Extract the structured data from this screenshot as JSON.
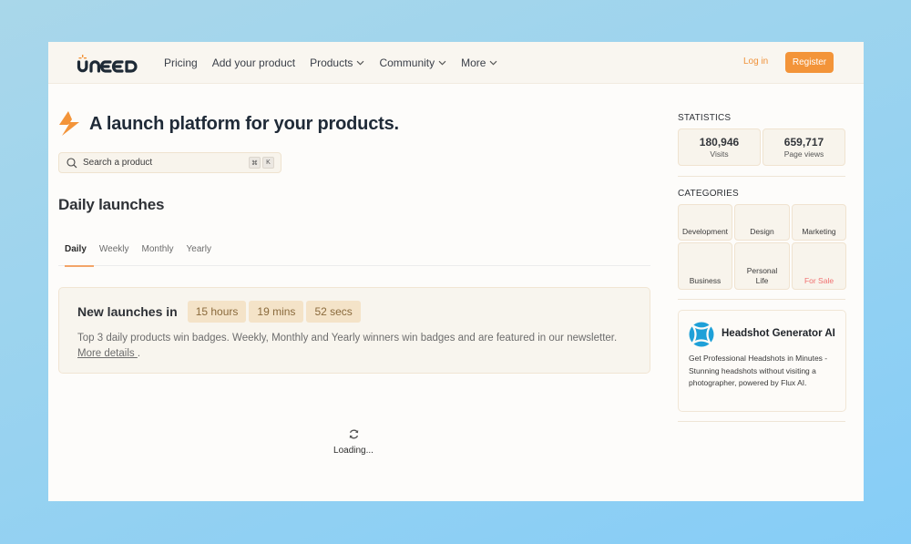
{
  "brand": {
    "name": "UNEED",
    "accent_color": "#f39439",
    "text_color": "#1f2a37"
  },
  "nav": {
    "items": [
      {
        "label": "Pricing",
        "has_dropdown": false
      },
      {
        "label": "Add your product",
        "has_dropdown": false
      },
      {
        "label": "Products",
        "has_dropdown": true
      },
      {
        "label": "Community",
        "has_dropdown": true
      },
      {
        "label": "More",
        "has_dropdown": true
      }
    ],
    "login_label": "Log in",
    "register_label": "Register"
  },
  "hero": {
    "icon": "lightning-bolt-icon",
    "title": "A launch platform for your products."
  },
  "search": {
    "placeholder": "Search a product",
    "shortcut_keys": [
      "⌘",
      "K"
    ]
  },
  "launches": {
    "title": "Daily launches",
    "tabs": [
      {
        "label": "Daily",
        "active": true
      },
      {
        "label": "Weekly",
        "active": false
      },
      {
        "label": "Monthly",
        "active": false
      },
      {
        "label": "Yearly",
        "active": false
      }
    ],
    "countdown": {
      "label": "New launches in",
      "hours": "15 hours",
      "mins": "19 mins",
      "secs": "52 secs"
    },
    "description": "Top 3 daily products win badges. Weekly, Monthly and Yearly winners win badges and are featured in our newsletter.",
    "more_details_link": "More details ",
    "more_details_suffix": ".",
    "loading_text": "Loading..."
  },
  "sidebar": {
    "statistics_title": "STATISTICS",
    "stats": [
      {
        "value": "180,946",
        "label": "Visits"
      },
      {
        "value": "659,717",
        "label": "Page views"
      }
    ],
    "categories_title": "CATEGORIES",
    "categories": [
      {
        "label": "Development"
      },
      {
        "label": "Design"
      },
      {
        "label": "Marketing"
      },
      {
        "label": "Business"
      },
      {
        "label": "Personal Life"
      },
      {
        "label": "For Sale",
        "highlight_color": "#f07070"
      }
    ],
    "ad": {
      "title": "Headshot Generator AI",
      "description": "Get Professional Headshots in Minutes - Stunning headshots without visiting a photographer, powered by Flux AI.",
      "logo_color": "#1ea0d8"
    }
  }
}
